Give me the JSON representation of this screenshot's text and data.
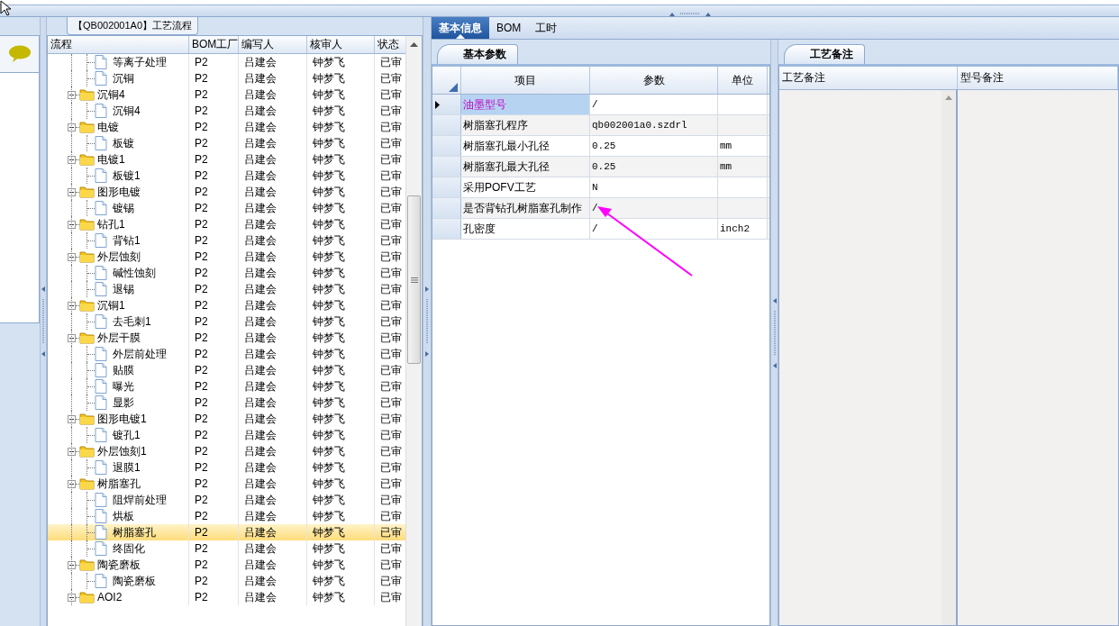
{
  "title_tab": "【QB002001A0】工艺流程",
  "tree": {
    "columns": [
      "流程",
      "BOM工厂",
      "编写人",
      "核审人",
      "状态"
    ],
    "rows": [
      {
        "kind": "leaf",
        "label": "等离子处理",
        "bom": "P2",
        "writer": "吕建会",
        "reviewer": "钟梦飞",
        "status": "已审",
        "selected": false
      },
      {
        "kind": "leaf",
        "label": "沉铜",
        "bom": "P2",
        "writer": "吕建会",
        "reviewer": "钟梦飞",
        "status": "已审",
        "selected": false
      },
      {
        "kind": "folder",
        "label": "沉铜4",
        "bom": "P2",
        "writer": "吕建会",
        "reviewer": "钟梦飞",
        "status": "已审",
        "expanded": true,
        "selected": false,
        "children": [
          {
            "kind": "leaf",
            "label": "沉铜4",
            "bom": "P2",
            "writer": "吕建会",
            "reviewer": "钟梦飞",
            "status": "已审",
            "selected": false
          }
        ]
      },
      {
        "kind": "folder",
        "label": "电镀",
        "bom": "P2",
        "writer": "吕建会",
        "reviewer": "钟梦飞",
        "status": "已审",
        "expanded": true,
        "selected": false,
        "children": [
          {
            "kind": "leaf",
            "label": "板镀",
            "bom": "P2",
            "writer": "吕建会",
            "reviewer": "钟梦飞",
            "status": "已审",
            "selected": false
          }
        ]
      },
      {
        "kind": "folder",
        "label": "电镀1",
        "bom": "P2",
        "writer": "吕建会",
        "reviewer": "钟梦飞",
        "status": "已审",
        "expanded": true,
        "selected": false,
        "children": [
          {
            "kind": "leaf",
            "label": "板镀1",
            "bom": "P2",
            "writer": "吕建会",
            "reviewer": "钟梦飞",
            "status": "已审",
            "selected": false
          }
        ]
      },
      {
        "kind": "folder",
        "label": "图形电镀",
        "bom": "P2",
        "writer": "吕建会",
        "reviewer": "钟梦飞",
        "status": "已审",
        "expanded": true,
        "selected": false,
        "children": [
          {
            "kind": "leaf",
            "label": "镀锡",
            "bom": "P2",
            "writer": "吕建会",
            "reviewer": "钟梦飞",
            "status": "已审",
            "selected": false
          }
        ]
      },
      {
        "kind": "folder",
        "label": "钻孔1",
        "bom": "P2",
        "writer": "吕建会",
        "reviewer": "钟梦飞",
        "status": "已审",
        "expanded": true,
        "selected": false,
        "children": [
          {
            "kind": "leaf",
            "label": "背钻1",
            "bom": "P2",
            "writer": "吕建会",
            "reviewer": "钟梦飞",
            "status": "已审",
            "selected": false
          }
        ]
      },
      {
        "kind": "folder",
        "label": "外层蚀刻",
        "bom": "P2",
        "writer": "吕建会",
        "reviewer": "钟梦飞",
        "status": "已审",
        "expanded": true,
        "selected": false,
        "children": [
          {
            "kind": "leaf",
            "label": "碱性蚀刻",
            "bom": "P2",
            "writer": "吕建会",
            "reviewer": "钟梦飞",
            "status": "已审",
            "selected": false
          },
          {
            "kind": "leaf",
            "label": "退锡",
            "bom": "P2",
            "writer": "吕建会",
            "reviewer": "钟梦飞",
            "status": "已审",
            "selected": false
          }
        ]
      },
      {
        "kind": "folder",
        "label": "沉铜1",
        "bom": "P2",
        "writer": "吕建会",
        "reviewer": "钟梦飞",
        "status": "已审",
        "expanded": true,
        "selected": false,
        "children": [
          {
            "kind": "leaf",
            "label": "去毛刺1",
            "bom": "P2",
            "writer": "吕建会",
            "reviewer": "钟梦飞",
            "status": "已审",
            "selected": false
          }
        ]
      },
      {
        "kind": "folder",
        "label": "外层干膜",
        "bom": "P2",
        "writer": "吕建会",
        "reviewer": "钟梦飞",
        "status": "已审",
        "expanded": true,
        "selected": false,
        "children": [
          {
            "kind": "leaf",
            "label": "外层前处理",
            "bom": "P2",
            "writer": "吕建会",
            "reviewer": "钟梦飞",
            "status": "已审",
            "selected": false
          },
          {
            "kind": "leaf",
            "label": "贴膜",
            "bom": "P2",
            "writer": "吕建会",
            "reviewer": "钟梦飞",
            "status": "已审",
            "selected": false
          },
          {
            "kind": "leaf",
            "label": "曝光",
            "bom": "P2",
            "writer": "吕建会",
            "reviewer": "钟梦飞",
            "status": "已审",
            "selected": false
          },
          {
            "kind": "leaf",
            "label": "显影",
            "bom": "P2",
            "writer": "吕建会",
            "reviewer": "钟梦飞",
            "status": "已审",
            "selected": false
          }
        ]
      },
      {
        "kind": "folder",
        "label": "图形电镀1",
        "bom": "P2",
        "writer": "吕建会",
        "reviewer": "钟梦飞",
        "status": "已审",
        "expanded": true,
        "selected": false,
        "children": [
          {
            "kind": "leaf",
            "label": "镀孔1",
            "bom": "P2",
            "writer": "吕建会",
            "reviewer": "钟梦飞",
            "status": "已审",
            "selected": false
          }
        ]
      },
      {
        "kind": "folder",
        "label": "外层蚀刻1",
        "bom": "P2",
        "writer": "吕建会",
        "reviewer": "钟梦飞",
        "status": "已审",
        "expanded": true,
        "selected": false,
        "children": [
          {
            "kind": "leaf",
            "label": "退膜1",
            "bom": "P2",
            "writer": "吕建会",
            "reviewer": "钟梦飞",
            "status": "已审",
            "selected": false
          }
        ]
      },
      {
        "kind": "folder",
        "label": "树脂塞孔",
        "bom": "P2",
        "writer": "吕建会",
        "reviewer": "钟梦飞",
        "status": "已审",
        "expanded": true,
        "selected": false,
        "children": [
          {
            "kind": "leaf",
            "label": "阻焊前处理",
            "bom": "P2",
            "writer": "吕建会",
            "reviewer": "钟梦飞",
            "status": "已审",
            "selected": false
          },
          {
            "kind": "leaf",
            "label": "烘板",
            "bom": "P2",
            "writer": "吕建会",
            "reviewer": "钟梦飞",
            "status": "已审",
            "selected": false
          },
          {
            "kind": "leaf",
            "label": "树脂塞孔",
            "bom": "P2",
            "writer": "吕建会",
            "reviewer": "钟梦飞",
            "status": "已审",
            "selected": true
          },
          {
            "kind": "leaf",
            "label": "终固化",
            "bom": "P2",
            "writer": "吕建会",
            "reviewer": "钟梦飞",
            "status": "已审",
            "selected": false
          }
        ]
      },
      {
        "kind": "folder",
        "label": "陶瓷磨板",
        "bom": "P2",
        "writer": "吕建会",
        "reviewer": "钟梦飞",
        "status": "已审",
        "expanded": true,
        "selected": false,
        "children": [
          {
            "kind": "leaf",
            "label": "陶瓷磨板",
            "bom": "P2",
            "writer": "吕建会",
            "reviewer": "钟梦飞",
            "status": "已审",
            "selected": false
          }
        ]
      },
      {
        "kind": "folder",
        "label": "AOI2",
        "bom": "P2",
        "writer": "吕建会",
        "reviewer": "钟梦飞",
        "status": "已审",
        "expanded": true,
        "selected": false
      }
    ]
  },
  "tabs": [
    {
      "label": "基本信息",
      "selected": true
    },
    {
      "label": "BOM",
      "selected": false
    },
    {
      "label": "工时",
      "selected": false
    }
  ],
  "params": {
    "tab": "基本参数",
    "columns": [
      "项目",
      "参数",
      "单位"
    ],
    "rows": [
      {
        "item": "油墨型号",
        "value": "/",
        "selected": true
      },
      {
        "item": "树脂塞孔程序",
        "value": "qb002001a0.szdrl",
        "selected": false
      },
      {
        "item": "树脂塞孔最小孔径",
        "value": "0.25",
        "unit": "mm",
        "selected": false
      },
      {
        "item": "树脂塞孔最大孔径",
        "value": "0.25",
        "unit": "mm",
        "selected": false
      },
      {
        "item": "采用POFV工艺",
        "value": "N",
        "selected": false
      },
      {
        "item": "是否背钻孔树脂塞孔制作",
        "value": "/",
        "selected": false
      },
      {
        "item": "孔密度",
        "value": "/",
        "unit": "inch2",
        "selected": false
      }
    ]
  },
  "notes": {
    "tab": "工艺备注",
    "columns": [
      "工艺备注",
      "型号备注"
    ]
  }
}
